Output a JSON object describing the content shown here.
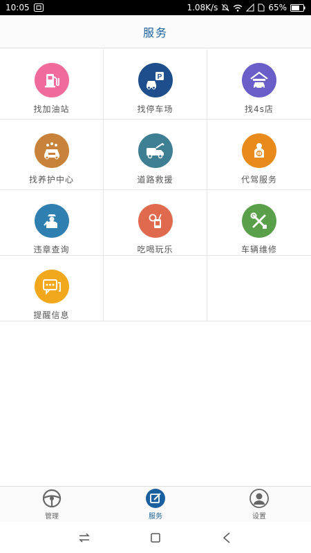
{
  "status_bar": {
    "time": "10:05",
    "net_speed": "1.08K/s",
    "battery": "65%"
  },
  "header": {
    "title": "服务"
  },
  "grid": [
    [
      {
        "label": "找加油站",
        "icon": "gas-station-icon",
        "color": "#f06a9c"
      },
      {
        "label": "找停车场",
        "icon": "parking-icon",
        "color": "#1f4e8c"
      },
      {
        "label": "找4s店",
        "icon": "car-dealer-icon",
        "color": "#6a5fc8"
      }
    ],
    [
      {
        "label": "找养护中心",
        "icon": "car-wash-icon",
        "color": "#c8823a"
      },
      {
        "label": "道路救援",
        "icon": "tow-truck-icon",
        "color": "#3f7f93"
      },
      {
        "label": "代驾服务",
        "icon": "chauffeur-icon",
        "color": "#e88a1c"
      }
    ],
    [
      {
        "label": "违章查询",
        "icon": "traffic-police-icon",
        "color": "#2f7fb0"
      },
      {
        "label": "吃喝玩乐",
        "icon": "food-drink-icon",
        "color": "#e06a4e"
      },
      {
        "label": "车辆维修",
        "icon": "repair-tools-icon",
        "color": "#5aa04a"
      }
    ],
    [
      {
        "label": "提醒信息",
        "icon": "message-icon",
        "color": "#f2a81c"
      }
    ]
  ],
  "bottom_nav": [
    {
      "label": "管理",
      "icon": "steering-wheel-icon",
      "active": false
    },
    {
      "label": "服务",
      "icon": "edit-icon",
      "active": true
    },
    {
      "label": "设置",
      "icon": "user-icon",
      "active": false
    }
  ],
  "colors": {
    "accent": "#1a5f9e"
  }
}
